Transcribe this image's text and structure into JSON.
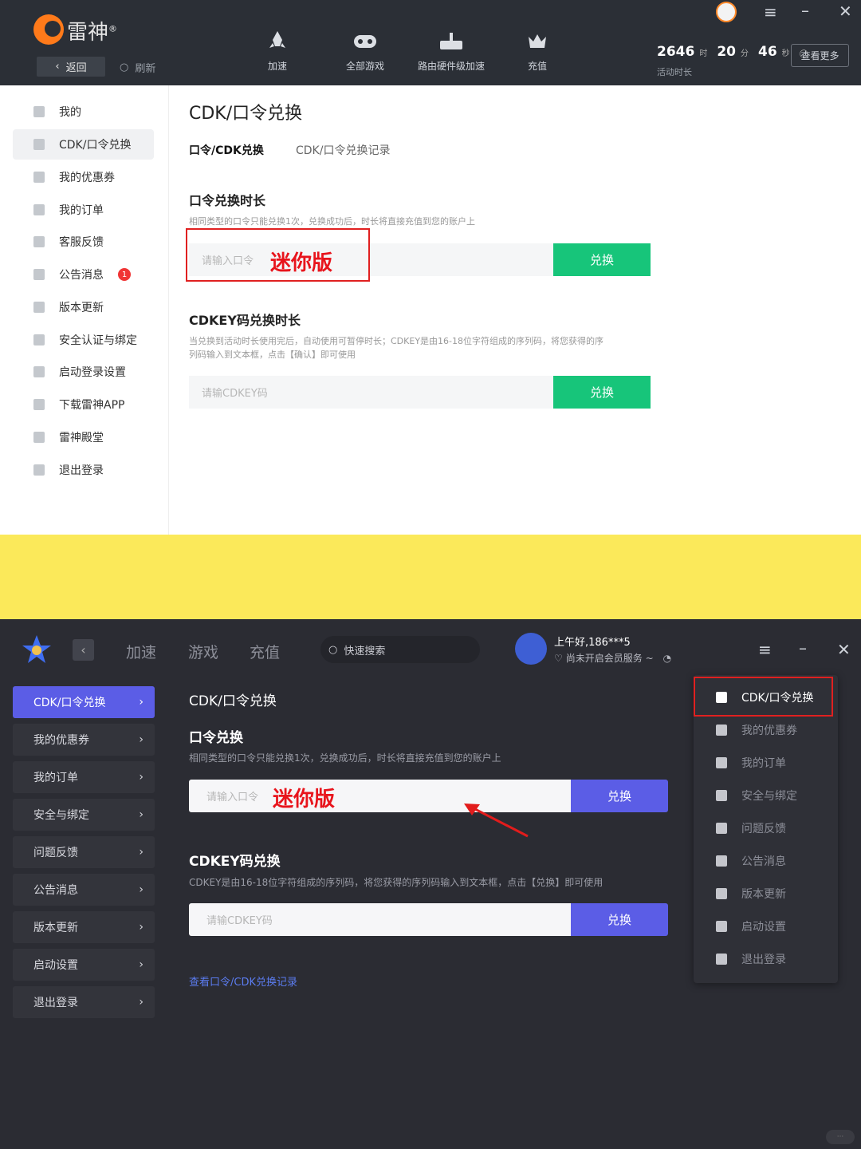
{
  "top": {
    "brand": "雷神",
    "back_label": "返回",
    "refresh_label": "刷新",
    "nav": [
      "加速",
      "全部游戏",
      "路由硬件级加速",
      "充值"
    ],
    "stats": {
      "hours": "2646",
      "hours_unit": "时",
      "minutes": "20",
      "minutes_unit": "分",
      "seconds": "46",
      "seconds_unit": "秒"
    },
    "active_label": "活动时长",
    "more_label": "查看更多",
    "sidebar": [
      "我的",
      "CDK/口令兑换",
      "我的优惠券",
      "我的订单",
      "客服反馈",
      "公告消息",
      "版本更新",
      "安全认证与绑定",
      "启动登录设置",
      "下载雷神APP",
      "雷神殿堂",
      "退出登录"
    ],
    "notice_badge": "1",
    "page_title": "CDK/口令兑换",
    "tabs": [
      "口令/CDK兑换",
      "CDK/口令兑换记录"
    ],
    "code_section": {
      "title": "口令兑换时长",
      "desc": "相同类型的口令只能兑换1次，兑换成功后，时长将直接充值到您的账户上",
      "placeholder": "请输入口令",
      "annotation": "迷你版",
      "button": "兑换"
    },
    "cdkey_section": {
      "title": "CDKEY码兑换时长",
      "desc_line1": "当兑换到活动时长使用完后，自动使用可暂停时长；CDKEY是由16-18位字符组成的序列码，将您获得的序",
      "desc_line2": "列码输入到文本框，点击【确认】即可使用",
      "placeholder": "请输CDKEY码",
      "button": "兑换"
    }
  },
  "bottom": {
    "nav": [
      "加速",
      "游戏",
      "充值"
    ],
    "search_placeholder": "快速搜索",
    "user_greeting": "上午好,186***5",
    "vip_status": "尚未开启会员服务 ~",
    "sidebar": [
      "CDK/口令兑换",
      "我的优惠券",
      "我的订单",
      "安全与绑定",
      "问题反馈",
      "公告消息",
      "版本更新",
      "启动设置",
      "退出登录"
    ],
    "page_title": "CDK/口令兑换",
    "code_section": {
      "title": "口令兑换",
      "desc": "相同类型的口令只能兑换1次，兑换成功后，时长将直接充值到您的账户上",
      "placeholder": "请输入口令",
      "annotation": "迷你版",
      "button": "兑换"
    },
    "cdkey_section": {
      "title": "CDKEY码兑换",
      "desc": "CDKEY是由16-18位字符组成的序列码，将您获得的序列码输入到文本框，点击【兑换】即可使用",
      "placeholder": "请输CDKEY码",
      "button": "兑换"
    },
    "record_link": "查看口令/CDK兑换记录",
    "dropdown": [
      "CDK/口令兑换",
      "我的优惠券",
      "我的订单",
      "安全与绑定",
      "问题反馈",
      "公告消息",
      "版本更新",
      "启动设置",
      "退出登录"
    ]
  },
  "colors": {
    "green": "#17c57a",
    "purple": "#5b5de6",
    "annotation_red": "#e8141c",
    "strip_yellow": "#fbe95a"
  }
}
